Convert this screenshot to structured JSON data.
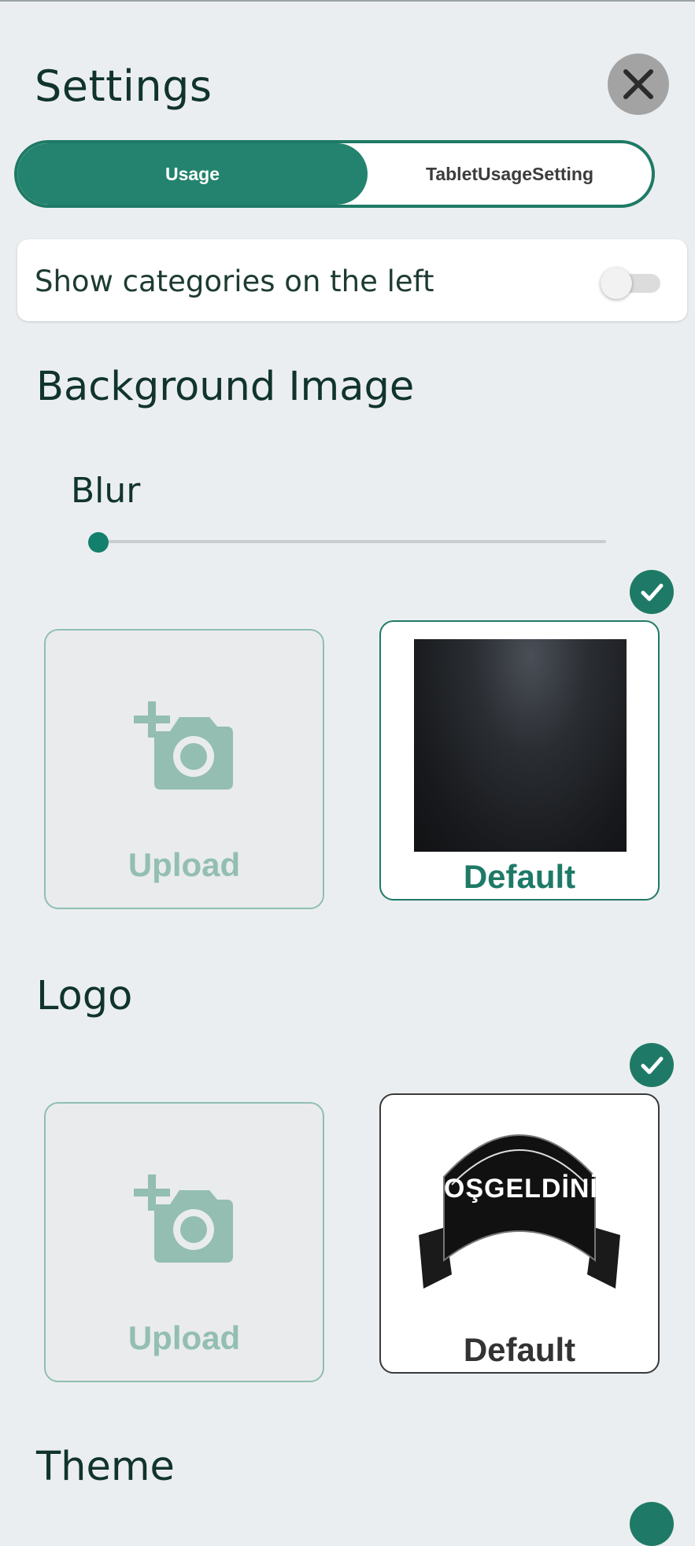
{
  "header": {
    "title": "Settings",
    "close_icon": "close-icon"
  },
  "tabs": [
    {
      "label": "Usage",
      "selected": true
    },
    {
      "label": "TabletUsageSetting",
      "selected": false
    }
  ],
  "show_categories": {
    "label": "Show categories on the left",
    "enabled": false
  },
  "background_image": {
    "heading": "Background Image",
    "blur": {
      "label": "Blur",
      "value": 0
    },
    "options": [
      {
        "label": "Upload",
        "icon": "add-photo-icon",
        "selected": false
      },
      {
        "label": "Default",
        "icon": "dark-texture-image",
        "selected": true
      }
    ]
  },
  "logo": {
    "heading": "Logo",
    "options": [
      {
        "label": "Upload",
        "icon": "add-photo-icon",
        "selected": false
      },
      {
        "label": "Default",
        "icon": "banner-logo-image",
        "image_text": "HOŞGELDİNİZ",
        "selected": true
      }
    ]
  },
  "theme": {
    "heading": "Theme"
  },
  "colors": {
    "accent": "#1e7a66",
    "upload_tint": "#93beb1",
    "background": "#ebeef0"
  }
}
